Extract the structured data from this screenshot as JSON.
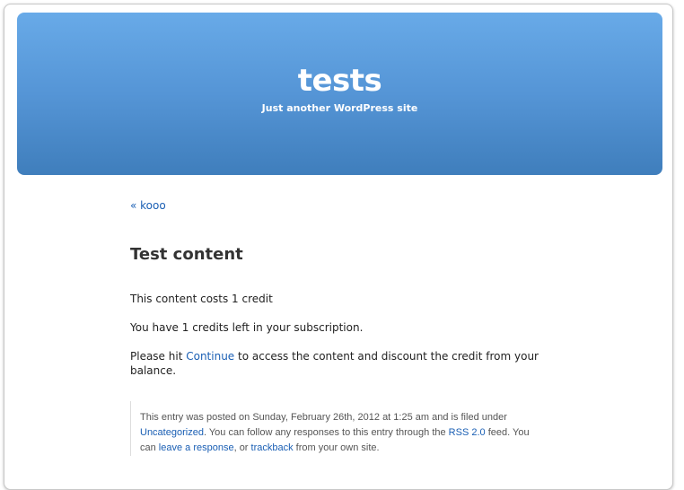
{
  "header": {
    "site_title": "tests",
    "site_description": "Just another WordPress site"
  },
  "navigation": {
    "previous_link": "« kooo"
  },
  "post": {
    "title": "Test content",
    "paragraph_1": "This content costs 1 credit",
    "paragraph_2": "You have 1 credits left in your subscription.",
    "paragraph_3_before": "Please hit ",
    "paragraph_3_link": "Continue",
    "paragraph_3_after": " to access the content and discount the credit from your balance."
  },
  "postmeta": {
    "text_1": "This entry was posted on Sunday, February 26th, 2012 at 1:25 am and is filed under ",
    "category_link": "Uncategorized",
    "text_2": ". You can follow any responses to this entry through the ",
    "rss_link": "RSS 2.0",
    "text_3": " feed. You can ",
    "response_link": "leave a response",
    "text_4": ", or ",
    "trackback_link": "trackback",
    "text_5": " from your own site."
  },
  "colors": {
    "link": "#1a5fb4",
    "header_top": "#68aae8",
    "header_bottom": "#3f7ebc"
  }
}
